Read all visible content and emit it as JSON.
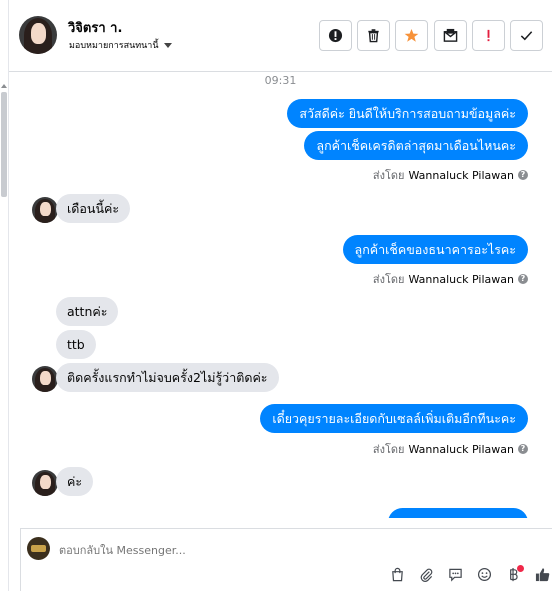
{
  "header": {
    "contact_name": "วิจิตรา า.",
    "assign_label": "มอบหมายการสนทนานี้",
    "actions": [
      {
        "name": "alert-circle-icon",
        "color": "#1c1e21"
      },
      {
        "name": "trash-icon",
        "color": "#1c1e21"
      },
      {
        "name": "star-icon",
        "color": "#f7923a"
      },
      {
        "name": "mark-unread-icon",
        "color": "#1c1e21"
      },
      {
        "name": "exclamation-icon",
        "color": "#e41e3f"
      },
      {
        "name": "check-icon",
        "color": "#1c1e21"
      }
    ]
  },
  "chat": {
    "timestamp": "09:31",
    "messages": [
      {
        "dir": "out",
        "text": "สวัสดีค่ะ ยินดีให้บริการสอบถามข้อมูลค่ะ"
      },
      {
        "dir": "out",
        "text": "ลูกค้าเช็คเครดิตล่าสุดมาเดือนไหนคะ"
      },
      {
        "dir": "sent_by",
        "prefix": "ส่งโดย",
        "agent": "Wannaluck Pilawan"
      },
      {
        "dir": "in",
        "text": "เดือนนี้ค่ะ"
      },
      {
        "dir": "out",
        "text": "ลูกค้าเช็คของธนาคารอะไรคะ"
      },
      {
        "dir": "sent_by",
        "prefix": "ส่งโดย",
        "agent": "Wannaluck Pilawan"
      },
      {
        "dir": "in",
        "text": "attnค่ะ"
      },
      {
        "dir": "in",
        "text": "ttb"
      },
      {
        "dir": "in",
        "text": "ติดครั้งแรกทำไม่จบครั้ง2ไม่รู้ว่าติดค่ะ"
      },
      {
        "dir": "out",
        "text": "เดี๋ยวคุยรายละเอียดกับเซลล์เพิ่มเติมอีกทีนะคะ"
      },
      {
        "dir": "sent_by",
        "prefix": "ส่งโดย",
        "agent": "Wannaluck Pilawan"
      },
      {
        "dir": "in",
        "text": "ค่ะ"
      }
    ]
  },
  "composer": {
    "placeholder": "ตอบกลับใน Messenger...",
    "icons": [
      "shopping-bag-icon",
      "attachment-icon",
      "saved-reply-icon",
      "emoji-icon",
      "baht-payment-icon",
      "like-icon"
    ],
    "notification_color": "#f02849"
  },
  "colors": {
    "outgoing_bubble": "#0084ff",
    "incoming_bubble": "#e4e6eb"
  }
}
